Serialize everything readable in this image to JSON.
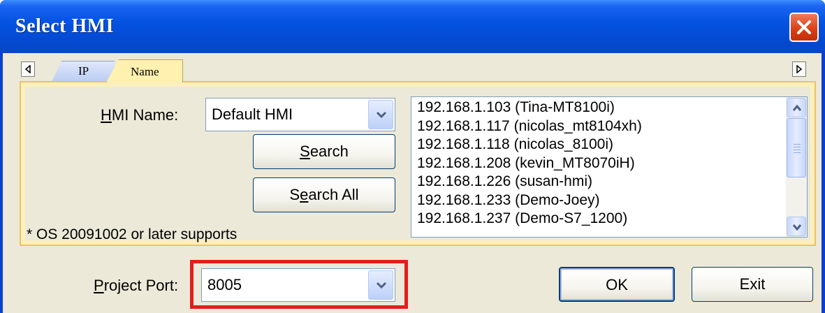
{
  "window": {
    "title": "Select HMI"
  },
  "tabs": [
    {
      "label": "IP",
      "active": false
    },
    {
      "label": "Name",
      "active": true
    }
  ],
  "hmi_name": {
    "label": "HMI Name:",
    "mnemonic": "H",
    "rest": "MI Name:",
    "value": "Default HMI"
  },
  "search_button": {
    "mnemonic": "S",
    "rest": "earch"
  },
  "search_all_button": {
    "pre": "S",
    "mnemonic": "e",
    "rest": "arch All"
  },
  "note": "* OS 20091002 or later supports",
  "hmi_list": [
    "192.168.1.103 (Tina-MT8100i)",
    "192.168.1.117 (nicolas_mt8104xh)",
    "192.168.1.118 (nicolas_8100i)",
    "192.168.1.208 (kevin_MT8070iH)",
    "192.168.1.226 (susan-hmi)",
    "192.168.1.233 (Demo-Joey)",
    "192.168.1.237 (Demo-S7_1200)"
  ],
  "project_port": {
    "mnemonic": "P",
    "rest": "roject Port:",
    "value": "8005"
  },
  "ok_button": "OK",
  "exit_button": "Exit",
  "colors": {
    "title_bar": "#0553e2",
    "active_tab": "#fff1b0",
    "highlight_box": "#e31d1d"
  }
}
